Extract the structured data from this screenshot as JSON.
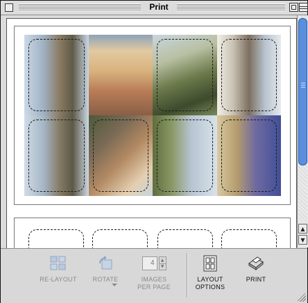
{
  "window": {
    "title": "Print"
  },
  "toolbar": {
    "relayout_label": "RE-LAYOUT",
    "rotate_label": "ROTATE",
    "images_per_page_label_line1": "IMAGES",
    "images_per_page_label_line2": "PER PAGE",
    "images_per_page_value": "4",
    "layout_options_label_line1": "LAYOUT",
    "layout_options_label_line2": "OPTIONS",
    "print_label": "PRINT"
  },
  "colors": {
    "scroll_thumb": "#5a8fe0",
    "chrome": "#dcdcdc"
  },
  "icons": {
    "relayout": "relayout-icon",
    "rotate": "rotate-icon",
    "layout_options": "layout-options-icon",
    "print": "printer-icon"
  }
}
